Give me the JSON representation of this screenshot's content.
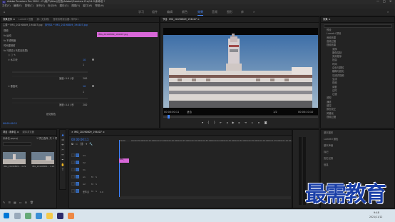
{
  "titlebar": {
    "app_badge": "Pr",
    "title": "Adobe Premiere Pro 2020 - C:\\用户\\Allorj\\文档\\Adobe\\Premiere Pro\\14.0\\未命名 *"
  },
  "menu": [
    "文件(F)",
    "编辑(E)",
    "剪辑(C)",
    "序列(S)",
    "标记(M)",
    "图形(G)",
    "视图(V)",
    "窗口(W)",
    "帮助(H)"
  ],
  "workspaces": {
    "items": [
      "学习",
      "组件",
      "编辑",
      "颜色",
      "效果",
      "音频",
      "图形",
      "库"
    ],
    "active_index": 4
  },
  "effect_controls": {
    "tabs": [
      "效果控件 ≡",
      "Lumetri 范围",
      "源: (无剪辑)",
      "音频剪辑混合器: 序列01"
    ],
    "source": "主要 * IMG_20190809_194407.jpg",
    "sequence": "序列01 * IMG_20190809_194407.jpg",
    "clip_label": "IMG_20190809_194407.jpg",
    "timecode": "00:00:00:11",
    "rows": [
      {
        "label": "视频",
        "value": ""
      },
      {
        "label": "fx 运动",
        "value": ""
      },
      {
        "label": "fx 不透明度",
        "value": ""
      },
      {
        "label": "时间重映射",
        "value": ""
      },
      {
        "label": "fx 马赛克 (马赛克效果)",
        "value": ""
      },
      {
        "label": "○ □ ✎",
        "value": ""
      },
      {
        "label": "⏱ 水平块",
        "value": "10"
      },
      {
        "label": "",
        "value": "1"
      },
      {
        "label": "",
        "value": "200"
      },
      {
        "label": "速度: 0.0 / 秒",
        "value": ""
      },
      {
        "label": "⏱ 垂直块",
        "value": "10"
      },
      {
        "label": "",
        "value": "1"
      },
      {
        "label": "",
        "value": "200"
      },
      {
        "label": "速度: 0.0 / 秒",
        "value": ""
      },
      {
        "label": "锐化颜色",
        "value": ""
      }
    ]
  },
  "program_monitor": {
    "title": "节目: IMG_20190809_194407 ≡",
    "timecode_left": "00:00:00:11",
    "fit": "适合",
    "quality": "1/2",
    "timecode_right": "00:00:10:10"
  },
  "project": {
    "tabs": [
      "项目: 未命名 ≡",
      "媒体浏览器",
      "库",
      "信息"
    ],
    "name": "未命名.prproj",
    "item_count": "1 项已选择, 共 2 项",
    "items": [
      {
        "name": "IMG_20190809...",
        "duration": "4:29"
      },
      {
        "name": "IMG_20190809...",
        "duration": "4:29"
      }
    ]
  },
  "timeline": {
    "tab": "× IMG_20190809_194407 ≡",
    "timecode": "00:00:00:11",
    "ruler": [
      "00:00",
      "00:00:05:00",
      "00:00:10:00",
      "00:00:15:00",
      "00:00:20:00",
      "00:00:25:00",
      "00:00:30:00",
      "00:00:35:00",
      "00:00:40:00",
      "00:00:45:00",
      "00:00:50:00",
      "00:00:55:00",
      "00:01:00:00",
      "00:01:05:00",
      "00:01:10:00"
    ],
    "video_tracks": [
      "V3",
      "V2",
      "V1"
    ],
    "audio_tracks": [
      "A1",
      "A2",
      "A3"
    ],
    "master": "主声道",
    "master_value": "0.0",
    "clip_label": "IMG_"
  },
  "effects_panel": {
    "title": "效果 ≡",
    "items": [
      "预设",
      "Lumetri 预设",
      "音频效果",
      "音频过渡",
      "视频效果",
      "变换",
      "图像控制",
      "实用程序",
      "扭曲",
      "时间",
      "杂色与颗粒",
      "模糊与锐化",
      "沉浸式视频",
      "生成",
      "视频",
      "调整",
      "过时",
      "过渡",
      "透视",
      "通道",
      "键控",
      "颜色校正",
      "风格化",
      "视频过渡"
    ],
    "lower": [
      "基本图形",
      "Lumetri 颜色",
      "基本声音",
      "标记",
      "历史记录",
      "信息"
    ]
  },
  "taskbar": {
    "time": "9:48",
    "date": "2021/11/12"
  },
  "watermark": "最需教育"
}
